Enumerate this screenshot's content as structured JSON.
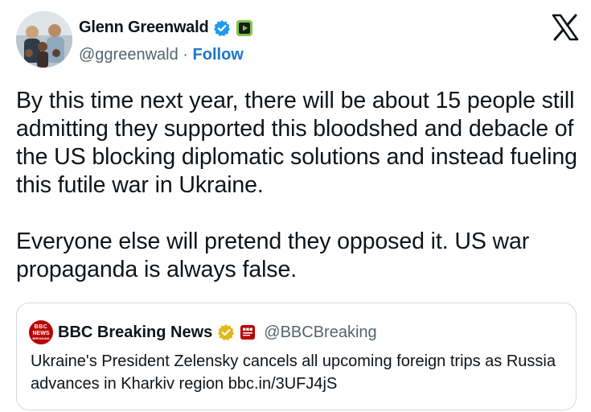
{
  "author": {
    "name": "Glenn Greenwald",
    "handle": "@ggreenwald",
    "separator": "·",
    "follow_label": "Follow",
    "icons": [
      "verified-badge-icon",
      "rumble-icon"
    ]
  },
  "platform_logo": "x-logo-icon",
  "tweet": {
    "paragraphs": [
      "By this time next year, there will be about 15 people still admitting they supported this bloodshed and debacle of the US blocking diplomatic solutions and instead fueling this futile war in Ukraine.",
      "Everyone else will pretend they opposed it. US war propaganda is always false."
    ]
  },
  "quoted_tweet": {
    "name": "BBC Breaking News",
    "handle": "@BBCBreaking",
    "logo_text": [
      "BBC",
      "NEWS",
      "BREAKING"
    ],
    "text": "Ukraine's President Zelensky cancels all upcoming foreign trips as Russia advances in Kharkiv region bbc.in/3UFJ4jS"
  },
  "colors": {
    "text": "#0f1419",
    "muted": "#536471",
    "link": "#1d77c2",
    "verified_blue": "#1d9bf0",
    "verified_gold": "#e2b719",
    "bbc_red": "#b80000",
    "rumble_green": "#85c742",
    "border": "#cfd9de"
  }
}
